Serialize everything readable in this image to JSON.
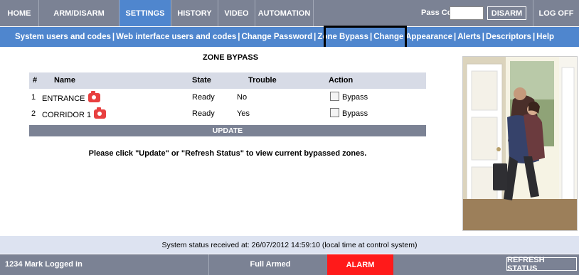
{
  "nav": {
    "tabs": [
      {
        "label": "HOME"
      },
      {
        "label": "ARM/DISARM"
      },
      {
        "label": "SETTINGS"
      },
      {
        "label": "HISTORY"
      },
      {
        "label": "VIDEO"
      },
      {
        "label": "AUTOMATION"
      }
    ],
    "active_tab": "SETTINGS",
    "pass_code_label": "Pass Code:",
    "pass_code_value": "",
    "disarm_label": "DISARM",
    "logoff_label": "LOG OFF"
  },
  "subnav": {
    "items": [
      {
        "label": "System users and codes"
      },
      {
        "label": "Web interface users and codes"
      },
      {
        "label": "Change Password"
      },
      {
        "label": "Zone Bypass"
      },
      {
        "label": "Change Appearance"
      },
      {
        "label": "Alerts"
      },
      {
        "label": "Descriptors"
      },
      {
        "label": "Help"
      }
    ],
    "separator": "|",
    "highlighted": "Zone Bypass"
  },
  "zone_bypass": {
    "title": "ZONE BYPASS",
    "columns": [
      "#",
      "Name",
      "State",
      "Trouble",
      "Action"
    ],
    "rows": [
      {
        "num": "1",
        "name": "ENTRANCE",
        "state": "Ready",
        "trouble": "No",
        "action": "Bypass",
        "icon": "camera-icon"
      },
      {
        "num": "2",
        "name": "CORRIDOR 1",
        "state": "Ready",
        "trouble": "Yes",
        "action": "Bypass",
        "icon": "camera-icon"
      }
    ],
    "update_label": "UPDATE",
    "info_text": "Please click \"Update\" or \"Refresh Status\" to view current bypassed zones."
  },
  "status": {
    "text": "System status received at: 26/07/2012 14:59:10 (local time at control system)"
  },
  "bottom": {
    "logged_in": "1234 Mark Logged in",
    "arm_state": "Full Armed",
    "alarm": "ALARM",
    "refresh_label": "REFRESH STATUS"
  },
  "colors": {
    "nav_bg": "#7b8294",
    "active_blue": "#4f86ce",
    "table_header": "#d7dbe6",
    "status_bg": "#dde3f1",
    "alarm_red": "#ff1a1a",
    "camera_red": "#e84040"
  }
}
